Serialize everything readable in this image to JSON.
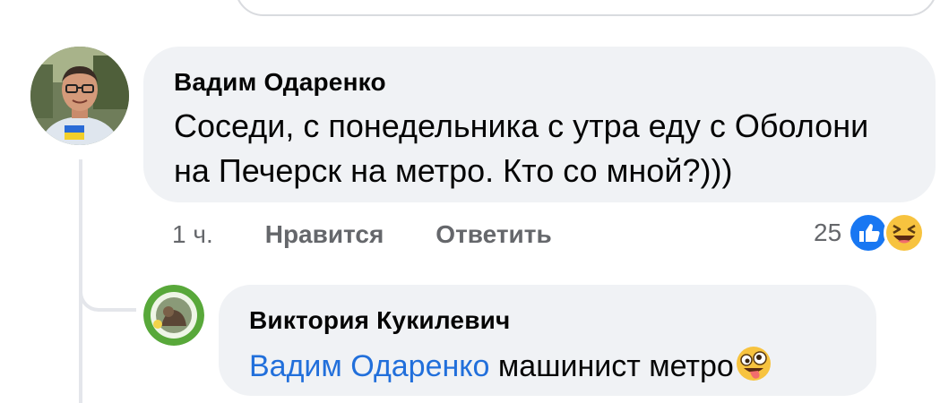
{
  "comment": {
    "author": "Вадим Одаренко",
    "text": "Соседи, с понедельника с утра еду с Оболони на Печерск на метро. Кто со мной?)))",
    "time": "1 ч.",
    "like_label": "Нравится",
    "reply_label": "Ответить",
    "reaction_count": "25",
    "reactions": [
      "like-icon",
      "haha-icon"
    ]
  },
  "reply": {
    "author": "Виктория Кукилевич",
    "mention": "Вадим Одаренко",
    "text": "машинист метро",
    "emoji": "zany-face-icon"
  },
  "colors": {
    "bubble": "#f0f2f5",
    "mention": "#216fdb",
    "meta": "#65676b",
    "like_blue": "#1877f2"
  }
}
